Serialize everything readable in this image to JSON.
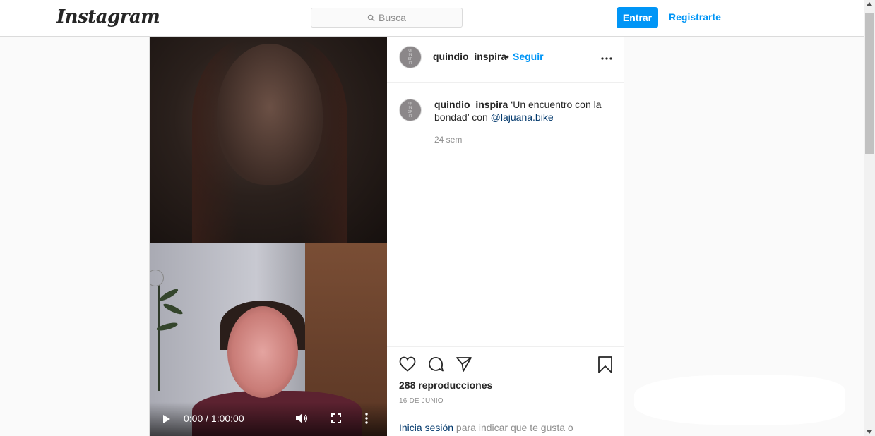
{
  "nav": {
    "logo": "Instagram",
    "search_placeholder": "Busca",
    "login_label": "Entrar",
    "signup_label": "Registrarte"
  },
  "post": {
    "username": "quindio_inspira",
    "dot": "•",
    "follow_label": "Seguir",
    "caption_user": "quindio_inspira",
    "caption_text": " ‘Un encuentro con la bondad’ con ",
    "caption_mention": "@lajuana.bike",
    "caption_time": "24 sem",
    "views": "288 reproducciones",
    "date": "16 DE JUNIO",
    "login_link": "Inicia sesión",
    "login_prompt": " para indicar que te gusta o"
  },
  "video": {
    "time": "0:00 / 1:00:00"
  },
  "icons": {
    "search": "search-icon",
    "options": "more-horizontal-icon",
    "like": "heart-icon",
    "comment": "comment-icon",
    "share": "paper-plane-icon",
    "save": "bookmark-icon",
    "play": "play-icon",
    "volume": "volume-icon",
    "fullscreen": "fullscreen-icon",
    "video_more": "more-vertical-icon"
  },
  "colors": {
    "accent": "#0095f6",
    "mention": "#00376b",
    "muted": "#8e8e8e",
    "border": "#dbdbdb"
  }
}
